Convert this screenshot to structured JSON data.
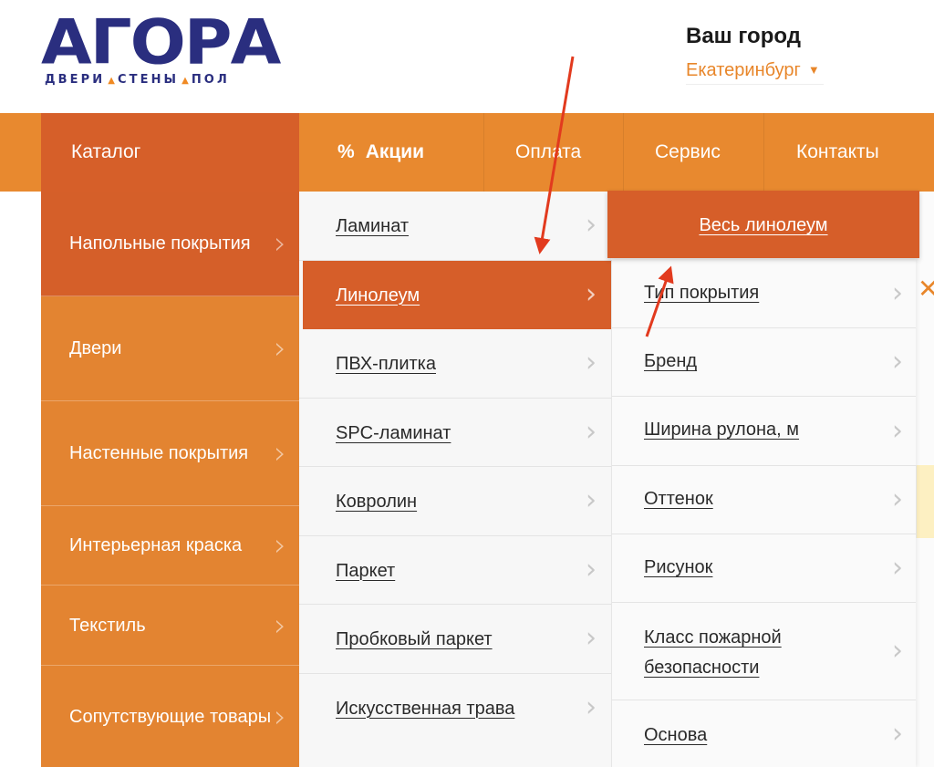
{
  "logo": {
    "word": "АГОРА",
    "tag_parts": [
      "ДВЕРИ",
      "СТЕНЫ",
      "ПОЛ"
    ]
  },
  "city": {
    "title": "Ваш город",
    "selected": "Екатеринбург"
  },
  "nav": {
    "catalog": "Каталог",
    "promo_symbol": "%",
    "promo": "Акции",
    "payment": "Оплата",
    "service": "Сервис",
    "contacts": "Контакты"
  },
  "menu_level1": [
    {
      "label": "Напольные покрытия",
      "active": true
    },
    {
      "label": "Двери"
    },
    {
      "label": "Настенные покрытия"
    },
    {
      "label": "Интерьерная краска"
    },
    {
      "label": "Текстиль"
    },
    {
      "label": "Сопутствующие товары"
    }
  ],
  "menu_level2": [
    {
      "label": "Ламинат"
    },
    {
      "label": "Линолеум",
      "active": true
    },
    {
      "label": "ПВХ-плитка"
    },
    {
      "label": "SPC-ламинат"
    },
    {
      "label": "Ковролин"
    },
    {
      "label": "Паркет"
    },
    {
      "label": "Пробковый паркет"
    },
    {
      "label": "Искусственная трава"
    }
  ],
  "menu_level3": {
    "all_label": "Весь линолеум",
    "items": [
      {
        "label": "Тип покрытия"
      },
      {
        "label": "Бренд"
      },
      {
        "label": "Ширина рулона, м"
      },
      {
        "label": "Оттенок"
      },
      {
        "label": "Рисунок"
      },
      {
        "label": "Класс пожарной безопасности"
      },
      {
        "label": "Основа"
      }
    ]
  },
  "colors": {
    "brand_blue": "#2a2e7f",
    "nav_orange": "#e8892f",
    "active_orange": "#d65e29",
    "annotation_arrow": "#e23a1e"
  }
}
